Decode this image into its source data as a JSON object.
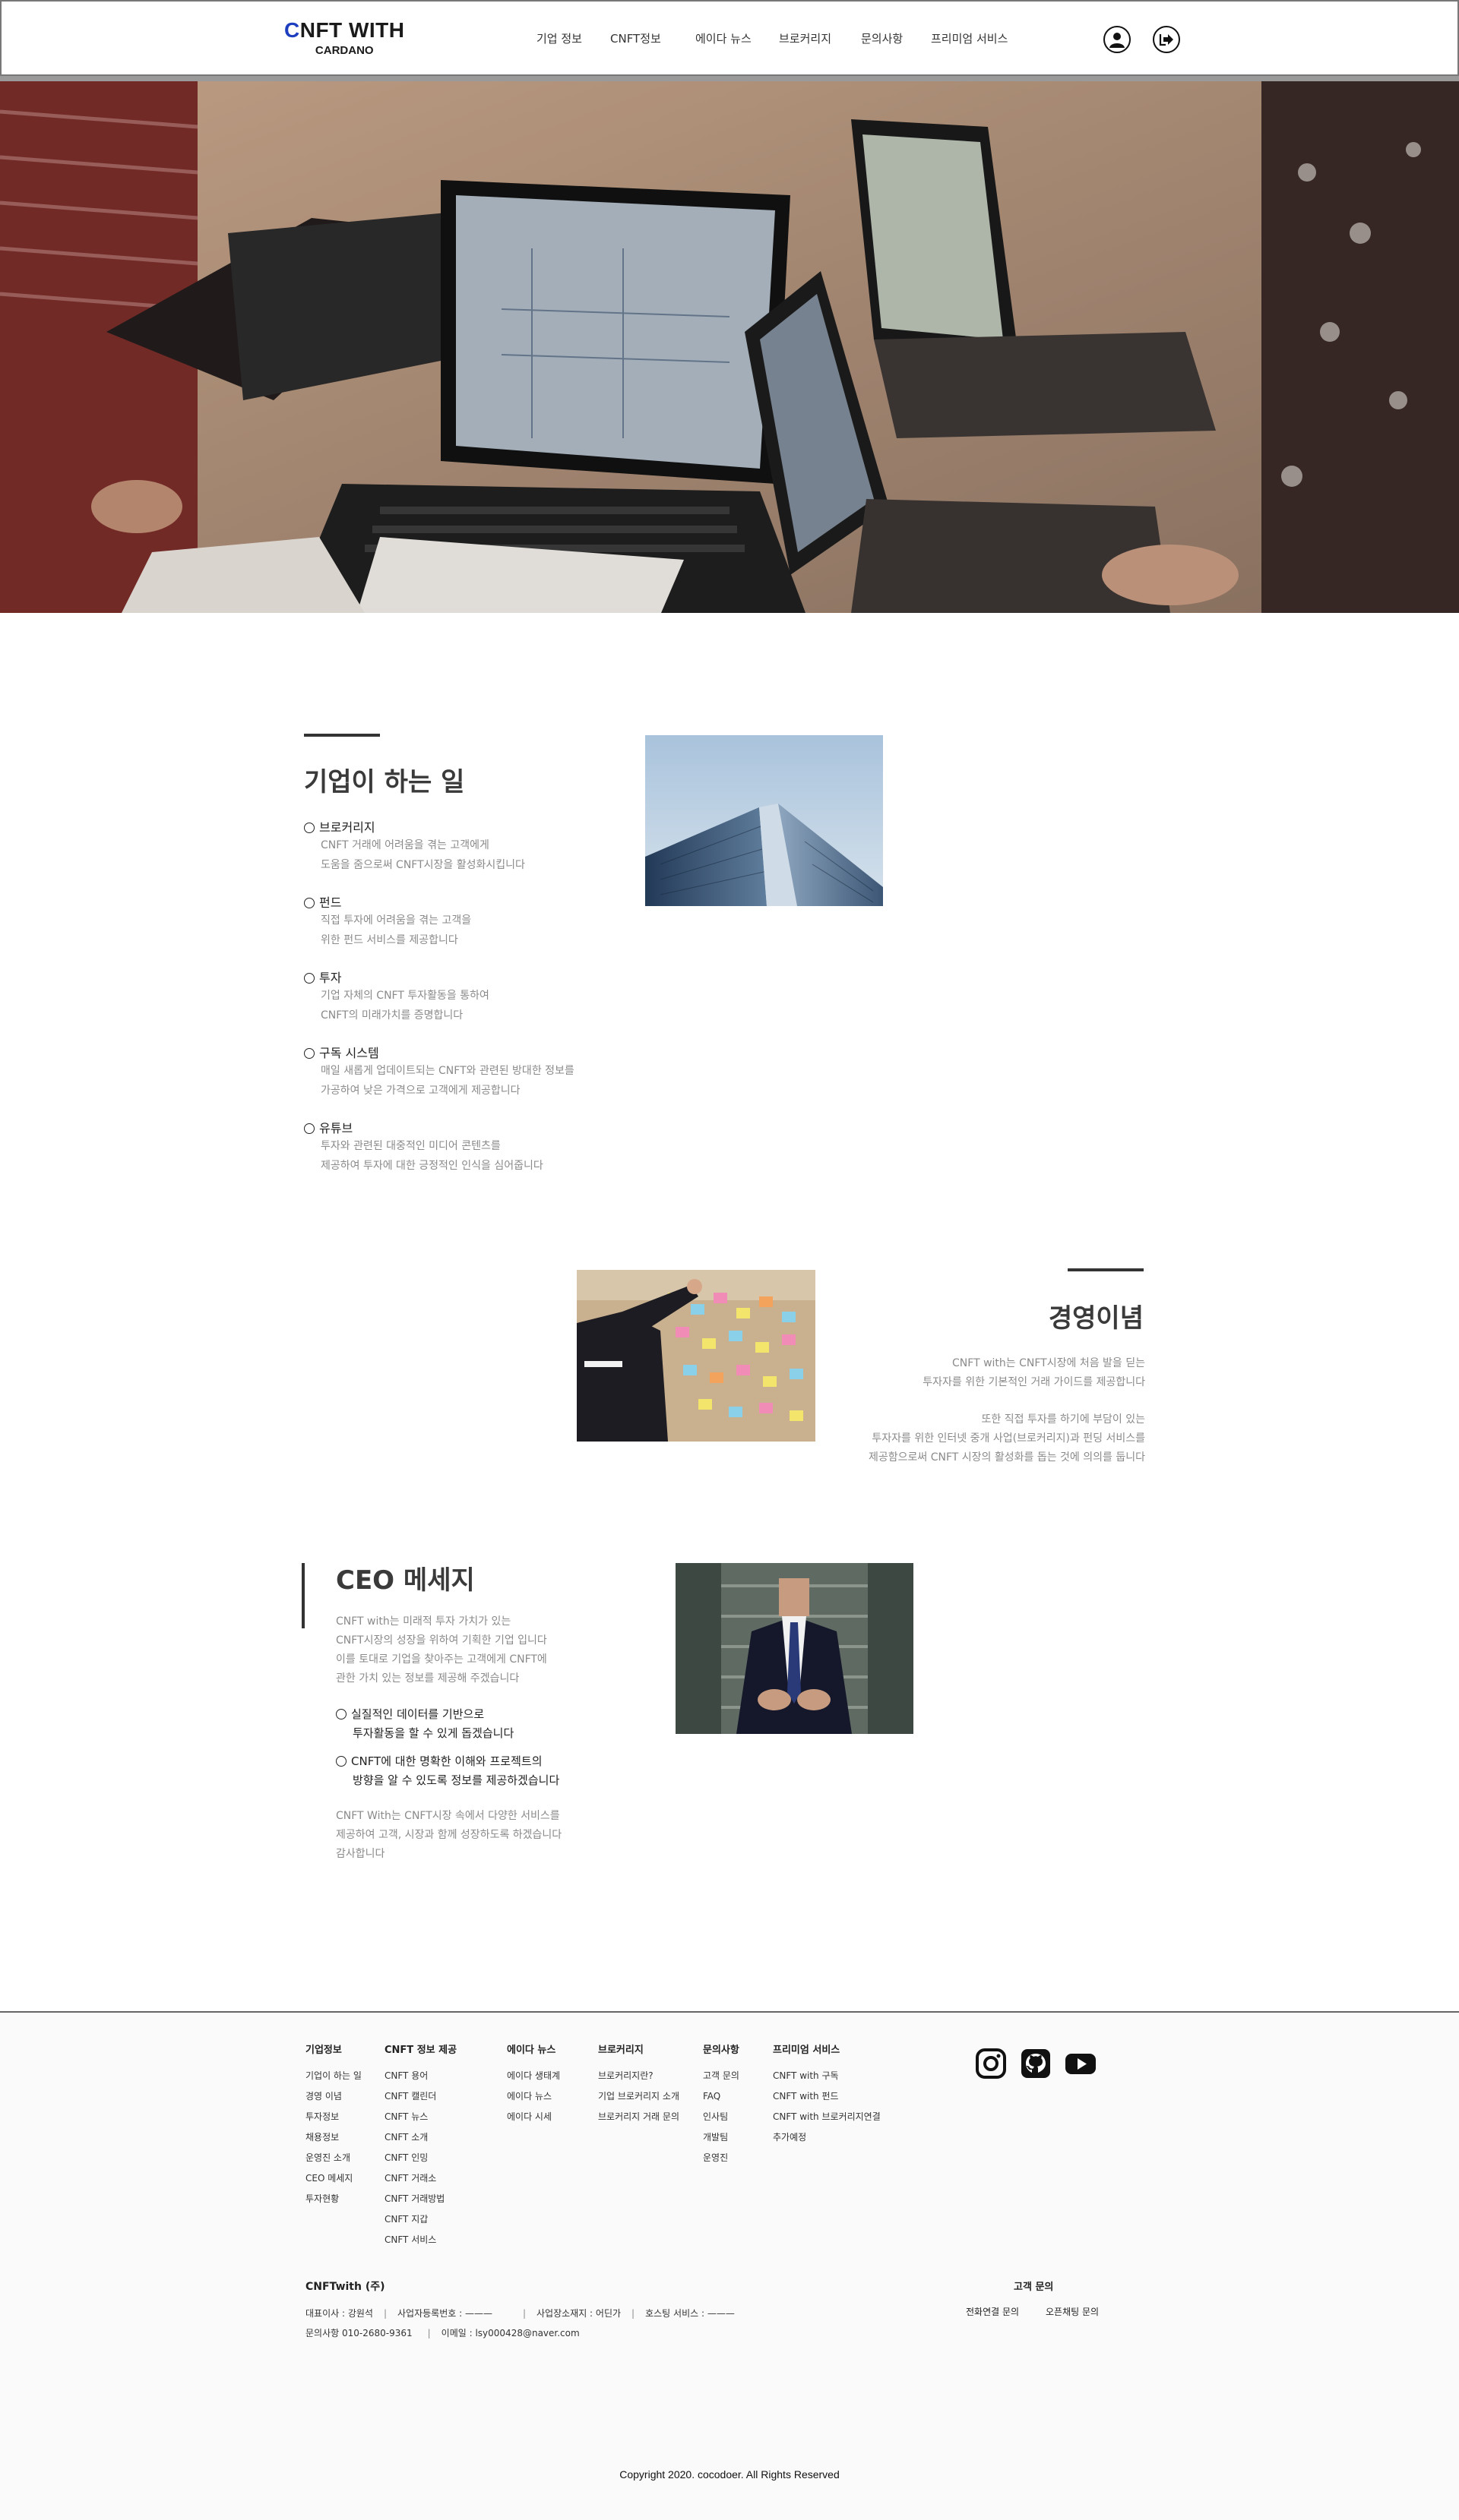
{
  "header": {
    "logo_prefix": "C",
    "logo_rest": "NFT WITH",
    "logo_sub": "CARDANO",
    "nav": [
      "기업 정보",
      "CNFT정보",
      "에이다 뉴스",
      "브로커리지",
      "문의사항",
      "프리미엄 서비스"
    ],
    "icons": [
      "user-icon",
      "logout-icon"
    ]
  },
  "about": {
    "title": "기업이 하는 일",
    "items": [
      {
        "title": "브로커리지",
        "desc1": "CNFT 거래에 어려움을 겪는 고객에게",
        "desc2": "도움을 줌으로써 CNFT시장을 활성화시킵니다"
      },
      {
        "title": "펀드",
        "desc1": "직접 투자에 어려움을 겪는 고객을",
        "desc2": "위한 펀드 서비스를 제공합니다"
      },
      {
        "title": "투자",
        "desc1": "기업 자체의 CNFT 투자활동을 통하여",
        "desc2": "CNFT의 미래가치를 증명합니다"
      },
      {
        "title": "구독 시스템",
        "desc1": "매일 새롭게 업데이트되는 CNFT와 관련된 방대한 정보를",
        "desc2": "가공하여 낮은 가격으로 고객에게 제공합니다"
      },
      {
        "title": "유튜브",
        "desc1": "투자와 관련된 대중적인 미디어 콘텐츠를",
        "desc2": "제공하여 투자에 대한 긍정적인 인식을 심어줍니다"
      }
    ]
  },
  "philosophy": {
    "title": "경영이념",
    "lines1": [
      "CNFT with는 CNFT시장에 처음 발을 딛는",
      "투자자를 위한 기본적인 거래 가이드를 제공합니다"
    ],
    "lines2": [
      "또한 직접 투자를 하기에 부담이 있는",
      "투자자를 위한 인터넷 중개 사업(브로커리지)과 펀딩 서비스를",
      "제공함으로써 CNFT 시장의 활성화를 돕는 것에 의의를 둡니다"
    ]
  },
  "ceo": {
    "title": "CEO 메세지",
    "intro": [
      "CNFT with는 미래적 투자 가치가 있는",
      "CNFT시장의 성장을 위하여 기획한 기업 입니다",
      "이를 토대로 기업을 찾아주는 고객에게 CNFT에",
      "관한 가치 있는 정보를 제공해 주겠습니다"
    ],
    "bullets": [
      {
        "l1": "실질적인 데이터를 기반으로",
        "l2": "투자활동을 할 수 있게 돕겠습니다"
      },
      {
        "l1": "CNFT에 대한 명확한 이해와 프로젝트의",
        "l2": "방향을 알 수 있도록 정보를 제공하겠습니다"
      }
    ],
    "outro": [
      "CNFT With는 CNFT시장 속에서 다양한 서비스를",
      "제공하여 고객, 시장과 함께 성장하도록 하겠습니다",
      "감사합니다"
    ]
  },
  "footer": {
    "columns": [
      {
        "head": "기업정보",
        "links": [
          "기업이 하는 일",
          "경영 이념",
          "투자정보",
          "채용정보",
          "운영진 소개",
          "CEO 메세지",
          "투자현황"
        ]
      },
      {
        "head": "CNFT 정보 제공",
        "links": [
          "CNFT 용어",
          "CNFT 캘린더",
          "CNFT 뉴스",
          "CNFT 소개",
          "CNFT 인밍",
          "CNFT 거래소",
          "CNFT 거래방법",
          "CNFT 지갑",
          "CNFT 서비스"
        ]
      },
      {
        "head": "에이다 뉴스",
        "links": [
          "에이다 생태계",
          "에이다 뉴스",
          "에이다 시세"
        ]
      },
      {
        "head": "브로커리지",
        "links": [
          "브로커리지란?",
          "기업 브로커리지 소개",
          "브로커리지 거래 문의"
        ]
      },
      {
        "head": "문의사항",
        "links": [
          "고객 문의",
          "FAQ",
          "인사팀",
          "개발팀",
          "운영진"
        ]
      },
      {
        "head": "프리미엄 서비스",
        "links": [
          "CNFT with 구독",
          "CNFT with 펀드",
          "CNFT with 브로커리지연결",
          "추가예정"
        ]
      }
    ],
    "social": [
      "instagram-icon",
      "github-icon",
      "youtube-icon"
    ],
    "company": "CNFTwith (주)",
    "info1": [
      "대표이사 : 강원석",
      "사업자등록번호 : ———",
      "사업장소재지 : 어딘가",
      "호스팅 서비스 : ———"
    ],
    "info2": [
      "문의사항  010-2680-9361",
      "이메일 : lsy000428@naver.com"
    ],
    "customer_title": "고객 문의",
    "customer_links": [
      "전화연결 문의",
      "오픈채팅 문의"
    ],
    "copyright": "Copyright 2020. cocodoer. All Rights Reserved"
  }
}
